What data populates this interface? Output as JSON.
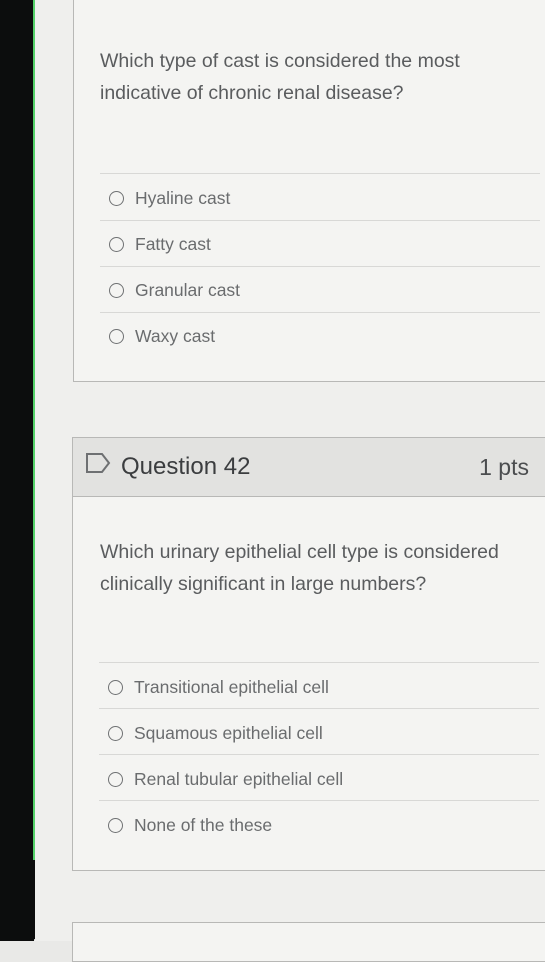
{
  "question_41": {
    "prompt": "Which type of cast is considered the most indicative of chronic renal disease?",
    "answers": [
      "Hyaline cast",
      "Fatty cast",
      "Granular cast",
      "Waxy cast"
    ]
  },
  "question_42": {
    "title": "Question 42",
    "points": "1 pts",
    "prompt": "Which urinary epithelial cell type is considered clinically significant in large numbers?",
    "answers": [
      "Transitional epithelial cell",
      "Squamous epithelial cell",
      "Renal tubular epithelial cell",
      "None of the these"
    ]
  },
  "icons": {
    "question_flag": "flag-outline-icon",
    "answer_radio": "radio-button-icon"
  }
}
